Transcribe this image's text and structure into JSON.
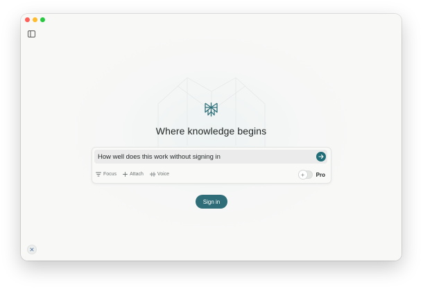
{
  "window": {
    "controls": [
      "close",
      "minimize",
      "zoom"
    ]
  },
  "icons": {
    "sidebar_toggle": "sidebar-icon",
    "logo": "perplexity-logo-icon",
    "submit": "arrow-right-icon",
    "focus": "filter-icon",
    "attach": "plus-icon",
    "voice": "waveform-icon",
    "pro_toggle": "sparkle-icon",
    "bottom": "close-icon"
  },
  "main": {
    "headline": "Where knowledge begins"
  },
  "search": {
    "value": "How well does this work without signing in",
    "tools": [
      {
        "label": "Focus"
      },
      {
        "label": "Attach"
      },
      {
        "label": "Voice"
      }
    ],
    "pro_label": "Pro"
  },
  "auth": {
    "signin_label": "Sign in"
  },
  "colors": {
    "accent": "#216d78",
    "signin": "#2f6e78",
    "background": "#f8f8f7"
  }
}
